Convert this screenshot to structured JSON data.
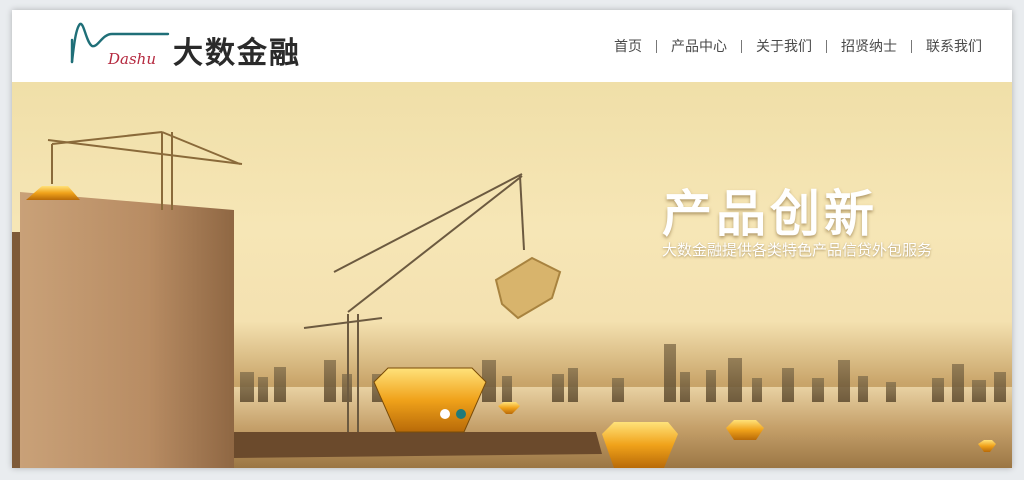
{
  "brand": {
    "name_en": "Dashu",
    "name_cn": "大数金融"
  },
  "nav": {
    "items": [
      {
        "label": "首页"
      },
      {
        "label": "产品中心"
      },
      {
        "label": "关于我们"
      },
      {
        "label": "招贤纳士"
      },
      {
        "label": "联系我们"
      }
    ]
  },
  "banner": {
    "title": "产品创新",
    "subtitle": "大数金融提供各类特色产品信贷外包服务",
    "slides_total": 2,
    "active_slide": 2
  },
  "colors": {
    "logo_teal": "#1f6f78",
    "logo_red": "#b5293f",
    "banner_gold": "#f4e1b0",
    "dot_active": "#1f7a7a"
  }
}
